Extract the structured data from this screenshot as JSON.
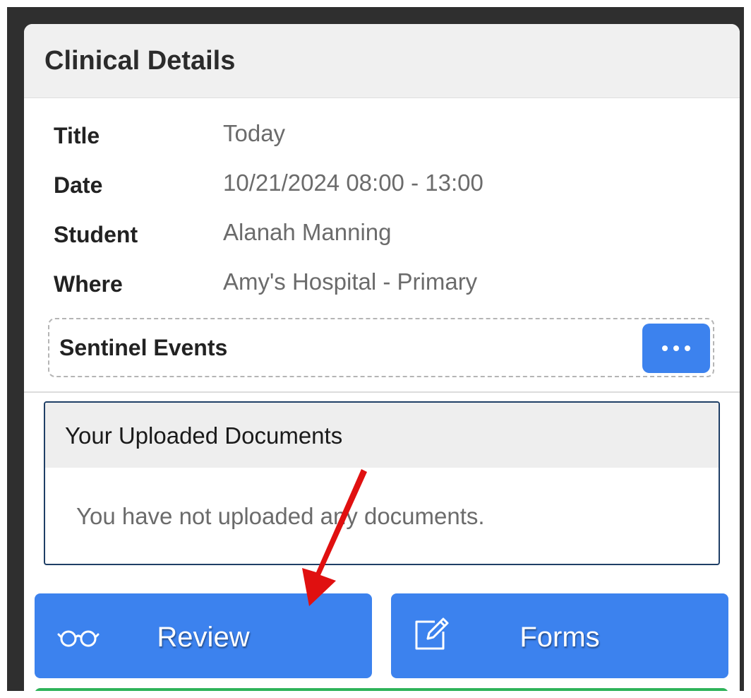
{
  "card": {
    "title": "Clinical Details"
  },
  "details": [
    {
      "label": "Title",
      "value": "Today"
    },
    {
      "label": "Date",
      "value": "10/21/2024 08:00 - 13:00"
    },
    {
      "label": "Student",
      "value": "Alanah Manning"
    },
    {
      "label": "Where",
      "value": "Amy's Hospital - Primary"
    }
  ],
  "sentinel": {
    "label": "Sentinel Events",
    "more_icon": "more-horizontal-icon"
  },
  "documents": {
    "title": "Your Uploaded Documents",
    "empty_message": "You have not uploaded any documents."
  },
  "actions": {
    "review": {
      "label": "Review",
      "icon": "glasses-icon"
    },
    "forms": {
      "label": "Forms",
      "icon": "edit-form-icon"
    }
  },
  "colors": {
    "primary_button": "#3c82ee",
    "header_bg": "#f0f0f0",
    "panel_border": "#1f3f66",
    "success": "#2fb35a",
    "annotation_arrow": "#e01010"
  }
}
